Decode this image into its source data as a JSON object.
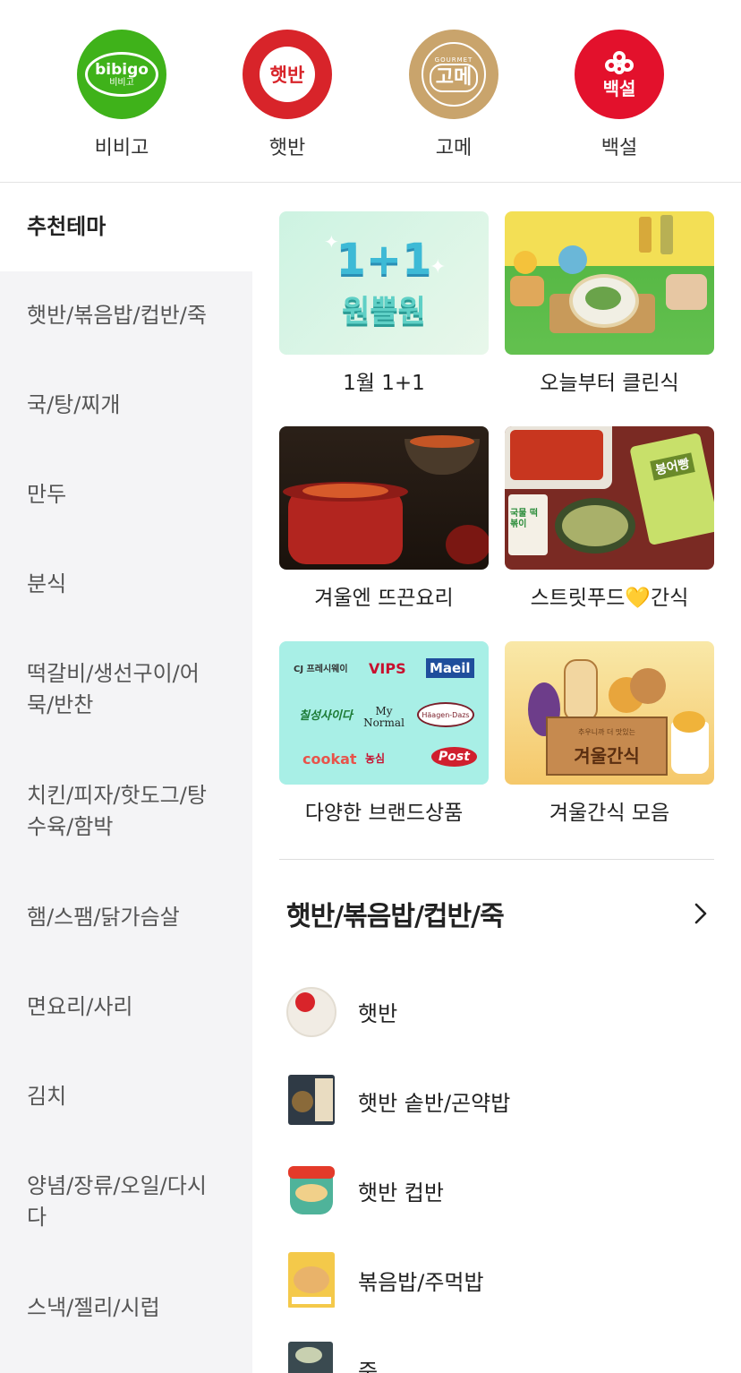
{
  "brands": [
    {
      "name": "비비고",
      "logo_text": "bibigo",
      "logo_sub": "비비고",
      "color": "#3fb21a"
    },
    {
      "name": "햇반",
      "logo_text": "햇반",
      "color": "#d8242a"
    },
    {
      "name": "고메",
      "logo_text": "고메",
      "logo_sub": "GOURMET",
      "color": "#c9a46c"
    },
    {
      "name": "백설",
      "logo_text": "백설",
      "color": "#e3112c"
    }
  ],
  "sidebar": {
    "items": [
      {
        "label": "추천테마"
      },
      {
        "label": "햇반/볶음밥/컵반/죽"
      },
      {
        "label": "국/탕/찌개"
      },
      {
        "label": "만두"
      },
      {
        "label": "분식"
      },
      {
        "label": "떡갈비/생선구이/어묵/반찬"
      },
      {
        "label": "치킨/피자/핫도그/탕수육/함박"
      },
      {
        "label": "햄/스팸/닭가슴살"
      },
      {
        "label": "면요리/사리"
      },
      {
        "label": "김치"
      },
      {
        "label": "양념/장류/오일/다시다"
      },
      {
        "label": "스낵/젤리/시럽"
      }
    ]
  },
  "themes": [
    {
      "label": "1월 1+1",
      "banner_line1": "1+1",
      "banner_line2": "원쁠원"
    },
    {
      "label": "오늘부터 클린식"
    },
    {
      "label": "겨울엔 뜨끈요리"
    },
    {
      "label": "스트릿푸드💛간식",
      "pack_text": "붕어빵",
      "pack_text2": "국물 떡볶이"
    },
    {
      "label": "다양한 브랜드상품",
      "logos": [
        "CJ 프레시웨이",
        "VIPS",
        "Maeil",
        "칠성사이다",
        "My Normal",
        "Häagen-Dazs",
        "cookat",
        "농심",
        "Post"
      ]
    },
    {
      "label": "겨울간식 모음",
      "box_text": "겨울간식",
      "box_sub": "추우니까 더 맛있는"
    }
  ],
  "section": {
    "title": "햇반/볶음밥/컵반/죽"
  },
  "products": [
    {
      "name": "햇반"
    },
    {
      "name": "햇반 솥반/곤약밥"
    },
    {
      "name": "햇반 컵반"
    },
    {
      "name": "볶음밥/주먹밥"
    },
    {
      "name": "죽"
    }
  ],
  "colors": {
    "sidebar_bg": "#f4f4f6",
    "divider": "#dddddd"
  }
}
